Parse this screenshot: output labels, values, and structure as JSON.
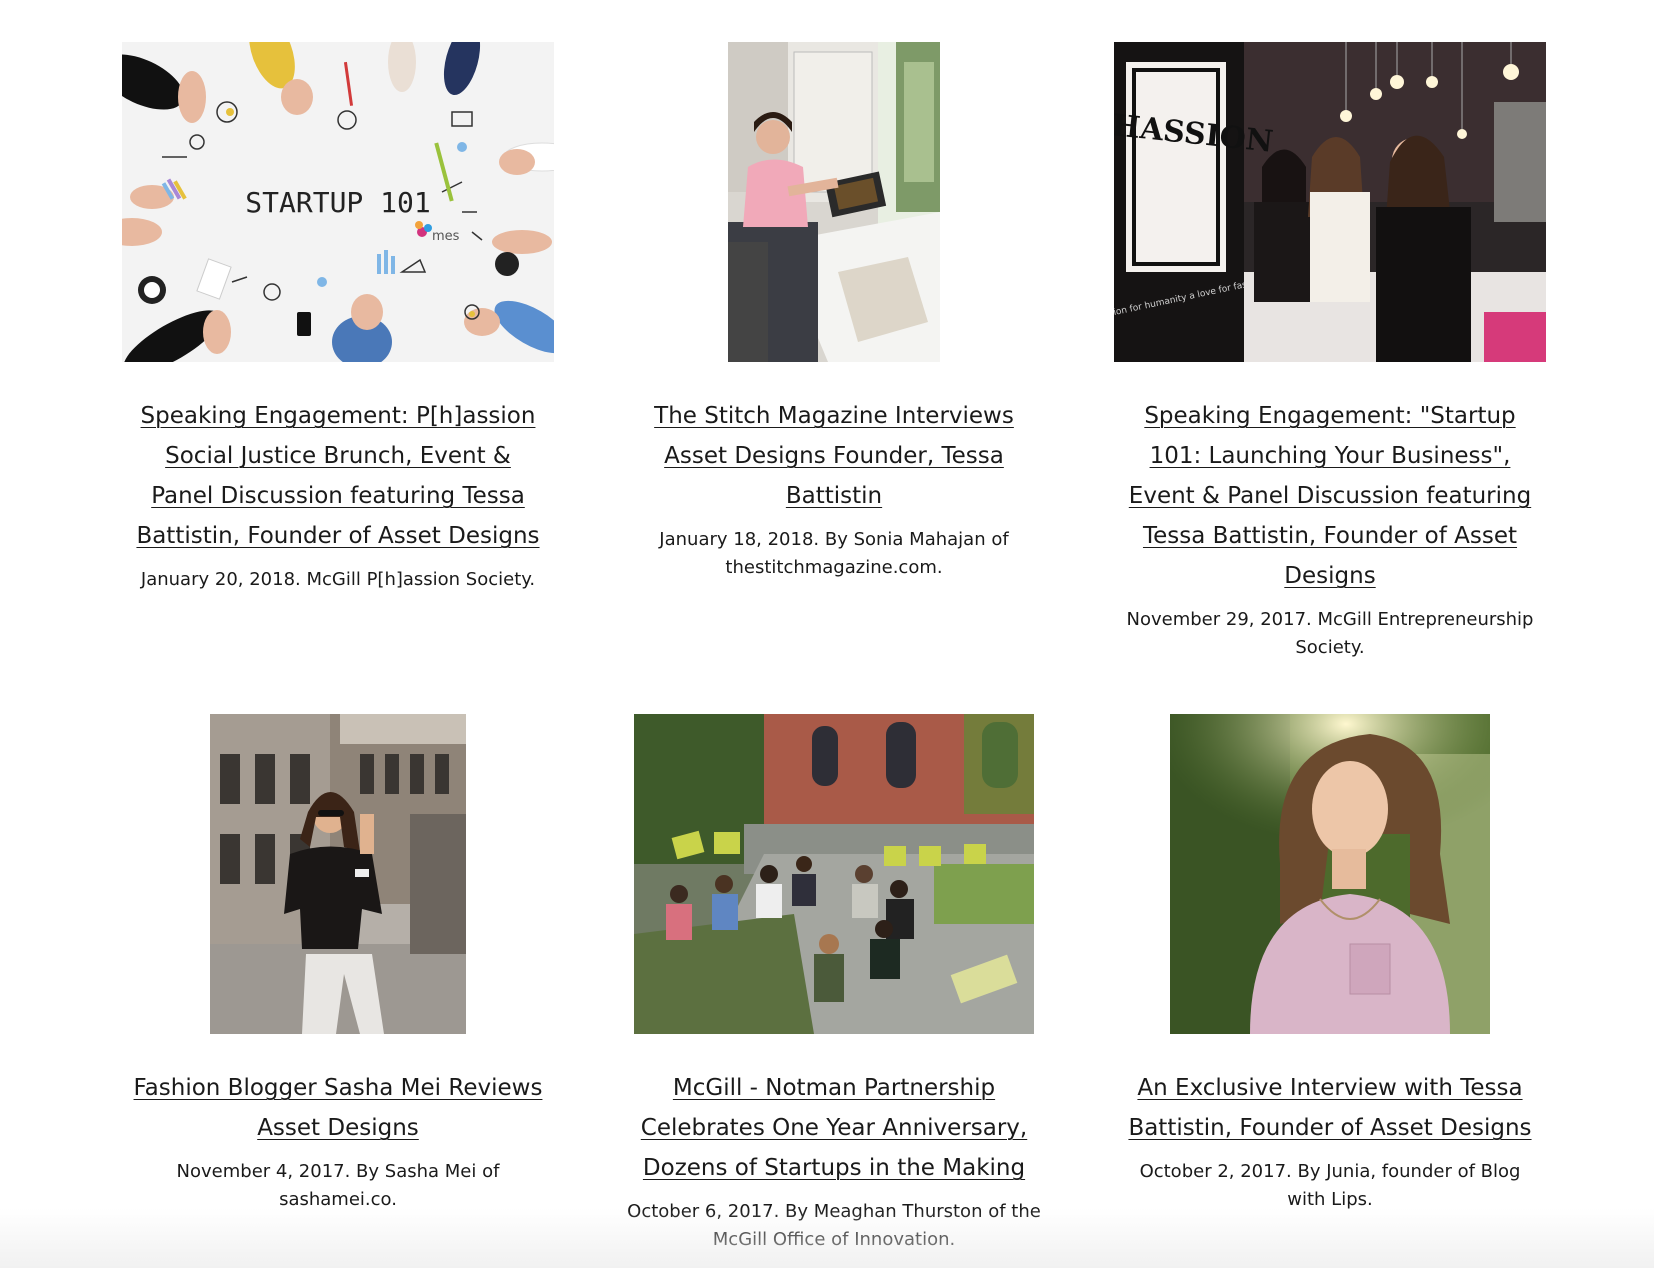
{
  "posts": [
    {
      "title": "Speaking Engagement: P[h]assion Social Justice Brunch, Event & Panel Discussion featuring Tessa Battistin, Founder of Asset Designs",
      "meta": "January 20, 2018. McGill P[h]assion Society.",
      "image_text": "STARTUP 101",
      "image_logo": "mes"
    },
    {
      "title": "The Stitch Magazine Interviews Asset Designs Founder, Tessa Battistin",
      "meta": "January 18, 2018. By Sonia Mahajan of thestitchmagazine.com."
    },
    {
      "title": "Speaking Engagement: \"Startup 101: Launching Your Business\", Event & Panel Discussion featuring Tessa Battistin, Founder of Asset Designs",
      "meta": "November 29, 2017. McGill Entrepreneurship Society.",
      "image_text": "PHASSION",
      "image_subtext": "a passion for humanity a love for fashion"
    },
    {
      "title": "Fashion Blogger Sasha Mei Reviews Asset Designs",
      "meta": "November 4, 2017. By Sasha Mei of sashamei.co."
    },
    {
      "title": "McGill - Notman Partnership Celebrates One Year Anniversary, Dozens of Startups in the Making",
      "meta": "October 6, 2017. By Meaghan Thurston of the McGill Office of Innovation."
    },
    {
      "title": "An Exclusive Interview with Tessa Battistin, Founder of Asset Designs",
      "meta": "October 2, 2017. By Junia, founder of Blog with Lips."
    }
  ]
}
